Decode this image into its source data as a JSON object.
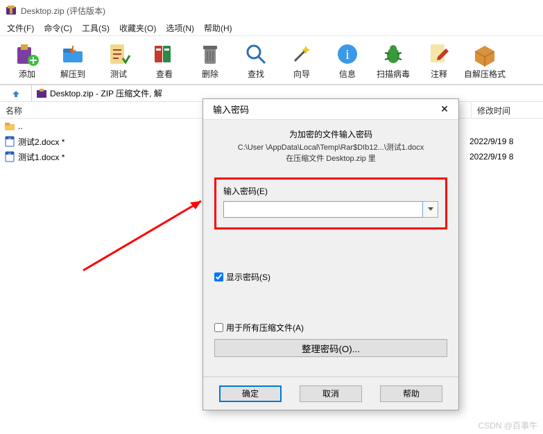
{
  "window": {
    "title": "Desktop.zip (评估版本)"
  },
  "menu": {
    "file": "文件(F)",
    "cmd": "命令(C)",
    "tools": "工具(S)",
    "fav": "收藏夹(O)",
    "opts": "选项(N)",
    "help": "帮助(H)"
  },
  "toolbar": {
    "add": "添加",
    "extract": "解压到",
    "test": "测试",
    "view": "查看",
    "delete": "删除",
    "find": "查找",
    "wizard": "向导",
    "info": "信息",
    "virus": "扫描病毒",
    "comment": "注释",
    "sfx": "自解压格式"
  },
  "address": {
    "path": "Desktop.zip - ZIP 压缩文件, 解"
  },
  "columns": {
    "name": "名称",
    "modified": "修改时间"
  },
  "files": [
    {
      "name": "..",
      "date": "",
      "type": "folder-up"
    },
    {
      "name": "测试2.docx *",
      "date": "2022/9/19 8",
      "type": "doc"
    },
    {
      "name": "测试1.docx *",
      "date": "2022/9/19 8",
      "type": "doc"
    }
  ],
  "dialog": {
    "title": "输入密码",
    "header": "为加密的文件输入密码",
    "path": "C:\\User               \\AppData\\Local\\Temp\\Rar$DIb12...\\测试1.docx",
    "in_archive": "在压缩文件 Desktop.zip 里",
    "input_label": "输入密码(E)",
    "input_value": "",
    "show_pwd": "显示密码(S)",
    "use_all": "用于所有压缩文件(A)",
    "manage": "整理密码(O)...",
    "ok": "确定",
    "cancel": "取消",
    "help": "帮助",
    "show_pwd_checked": true,
    "use_all_checked": false
  },
  "watermark": "CSDN @百事牛"
}
